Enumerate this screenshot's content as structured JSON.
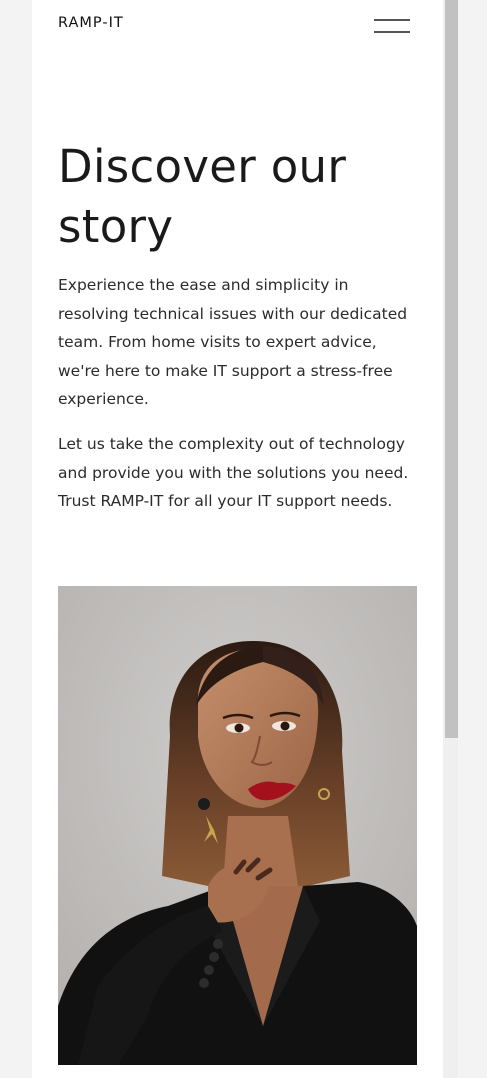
{
  "header": {
    "brand": "RAMP-IT",
    "menu_icon": "hamburger-menu-icon"
  },
  "hero": {
    "title_line1": "Discover our",
    "title_line2": "story",
    "paragraph1": "Experience the ease and simplicity in resolving technical issues with our dedicated team. From home visits to expert advice, we're here to make IT support a stress-free experience.",
    "paragraph2": "Let us take the complexity out of technology and provide you with the solutions you need. Trust RAMP-IT for all your IT support needs."
  },
  "colors": {
    "page_bg": "#ffffff",
    "text": "#1a1a1a",
    "photo_bg": "#c6c3c1",
    "jacket": "#111111",
    "lips": "#a3121c"
  }
}
